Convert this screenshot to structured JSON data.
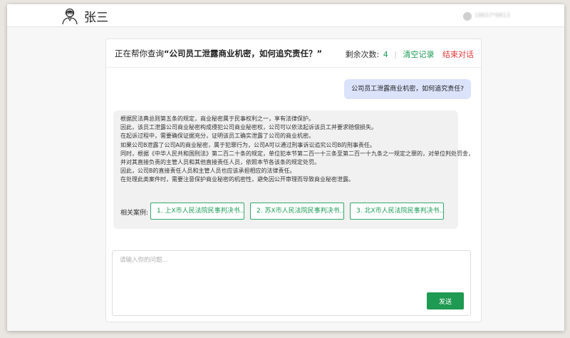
{
  "header": {
    "username": "张三",
    "account_name": "18657*8813"
  },
  "chat": {
    "title_prefix": "正在帮你查询",
    "title_query": "“公司员工泄露商业机密，如何追究责任？”",
    "remaining_label": "剩余次数:",
    "remaining_count": "4",
    "clear_label": "清空记录",
    "end_label": "结束对话",
    "user_message": "公司员工泄露商业机密，如何追究责任?",
    "answer_lines": [
      "根据民法典总则第五条的规定，商业秘密属于民事权利之一，享有法律保护。",
      "因此，该员工泄露公司商业秘密构成侵犯公司商业秘密权，公司可以依法起诉该员工并要求赔偿损失。",
      "在起诉过程中，需要确保证据充分，证明该员工确实泄露了公司的商业机密。",
      "如果公司B泄露了公司A的商业秘密，属于犯罪行为，公司A可以通过刑事诉讼追究公司B的刑事责任。",
      "同时，根据《中华人民共和国刑法》第二百二十条的规定，单位犯本节第二百一十三条至第二百一十九条之一规定之罪的，对单位判处罚金，",
      "并对其直接负责的主管人员和其他直接责任人员，依照本节各该条的规定处罚。",
      "因此，公司B的直接责任人员和主管人员也应该承担相应的法律责任。",
      "在处理此类案件时，需要注意保护商业秘密的机密性，避免因公开审理而导致商业秘密泄露。"
    ],
    "related_label": "相关案例:",
    "related_cases": [
      "1. 上X市人民法院民事判决书...",
      "2. 苏X市人民法院民事判决书...",
      "3. 北X市人民法院民事判决书..."
    ],
    "input_placeholder": "请输入你的问题...",
    "send_label": "发送"
  },
  "colors": {
    "accent_green": "#1f9a52",
    "end_red": "#e23b3b",
    "user_bubble": "#dbe3fb"
  }
}
